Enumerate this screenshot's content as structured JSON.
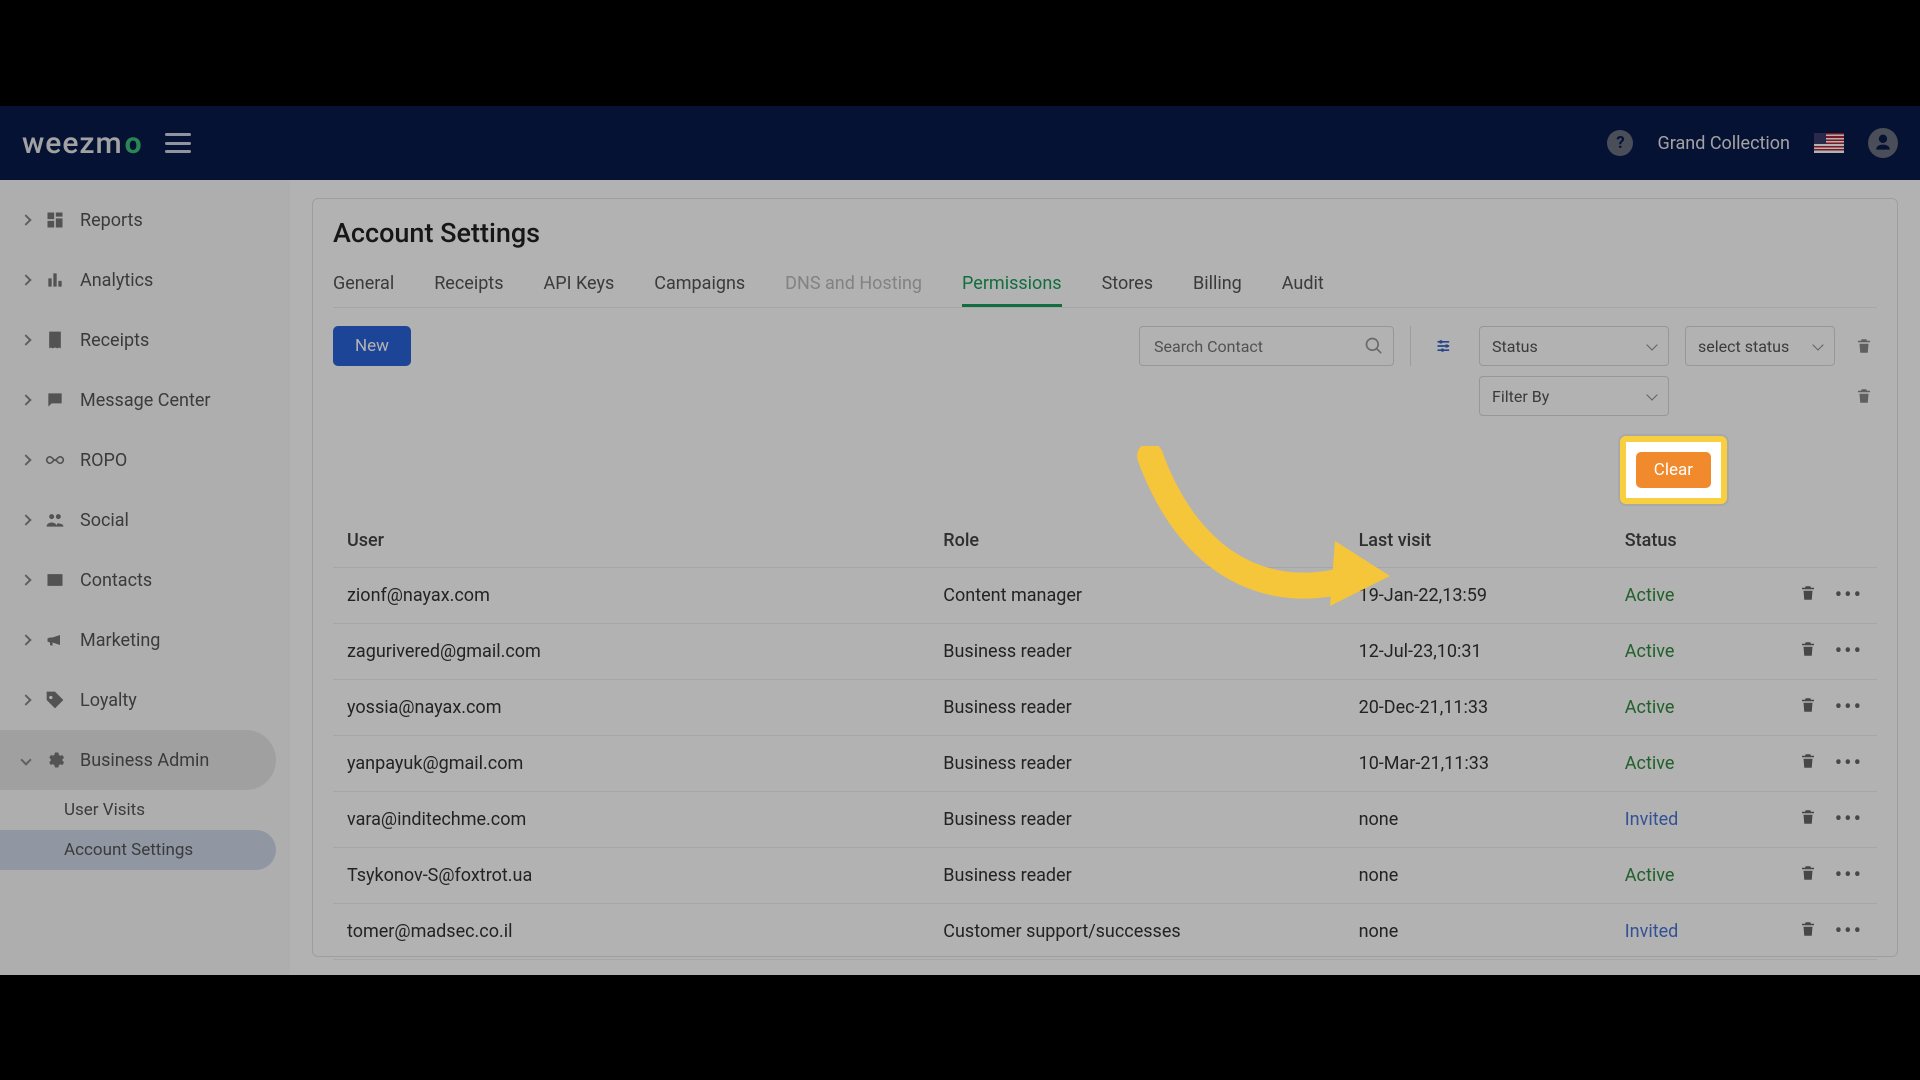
{
  "brand": {
    "name": "weezm",
    "accent_char": "o"
  },
  "header": {
    "help_tooltip": "Help",
    "username": "Grand Collection"
  },
  "sidebar": {
    "items": [
      {
        "label": "Reports",
        "icon": "dashboard-icon"
      },
      {
        "label": "Analytics",
        "icon": "bar-chart-icon"
      },
      {
        "label": "Receipts",
        "icon": "receipt-icon"
      },
      {
        "label": "Message Center",
        "icon": "chat-icon"
      },
      {
        "label": "ROPO",
        "icon": "infinity-icon"
      },
      {
        "label": "Social",
        "icon": "people-icon"
      },
      {
        "label": "Contacts",
        "icon": "contact-card-icon"
      },
      {
        "label": "Marketing",
        "icon": "megaphone-icon"
      },
      {
        "label": "Loyalty",
        "icon": "tag-icon"
      },
      {
        "label": "Business Admin",
        "icon": "gear-icon",
        "expanded": true,
        "children": [
          {
            "label": "User Visits"
          },
          {
            "label": "Account Settings",
            "active": true
          }
        ]
      }
    ]
  },
  "page": {
    "title": "Account Settings"
  },
  "tabs": [
    {
      "label": "General"
    },
    {
      "label": "Receipts"
    },
    {
      "label": "API Keys"
    },
    {
      "label": "Campaigns"
    },
    {
      "label": "DNS and Hosting",
      "disabled": true
    },
    {
      "label": "Permissions",
      "active": true
    },
    {
      "label": "Stores"
    },
    {
      "label": "Billing"
    },
    {
      "label": "Audit"
    }
  ],
  "toolbar": {
    "new_label": "New",
    "search_placeholder": "Search Contact",
    "status_label": "Status",
    "select_status_label": "select status",
    "filter_by_label": "Filter By",
    "clear_label": "Clear"
  },
  "table": {
    "columns": {
      "user": "User",
      "role": "Role",
      "last_visit": "Last visit",
      "status": "Status"
    },
    "rows": [
      {
        "user": "zionf@nayax.com",
        "role": "Content manager",
        "last_visit": "19-Jan-22,13:59",
        "status": "Active",
        "status_kind": "active"
      },
      {
        "user": "zagurivered@gmail.com",
        "role": "Business reader",
        "last_visit": "12-Jul-23,10:31",
        "status": "Active",
        "status_kind": "active"
      },
      {
        "user": "yossia@nayax.com",
        "role": "Business reader",
        "last_visit": "20-Dec-21,11:33",
        "status": "Active",
        "status_kind": "active"
      },
      {
        "user": "yanpayuk@gmail.com",
        "role": "Business reader",
        "last_visit": "10-Mar-21,11:33",
        "status": "Active",
        "status_kind": "active"
      },
      {
        "user": "vara@inditechme.com",
        "role": "Business reader",
        "last_visit": "none",
        "status": "Invited",
        "status_kind": "invited"
      },
      {
        "user": "Tsykonov-S@foxtrot.ua",
        "role": "Business reader",
        "last_visit": "none",
        "status": "Active",
        "status_kind": "active"
      },
      {
        "user": "tomer@madsec.co.il",
        "role": "Customer support/successes",
        "last_visit": "none",
        "status": "Invited",
        "status_kind": "invited"
      }
    ]
  },
  "colors": {
    "accent_green": "#1a9e5c",
    "primary_blue": "#2962d9",
    "clear_orange": "#f08a2c",
    "highlight_yellow": "#f8cf3e"
  }
}
